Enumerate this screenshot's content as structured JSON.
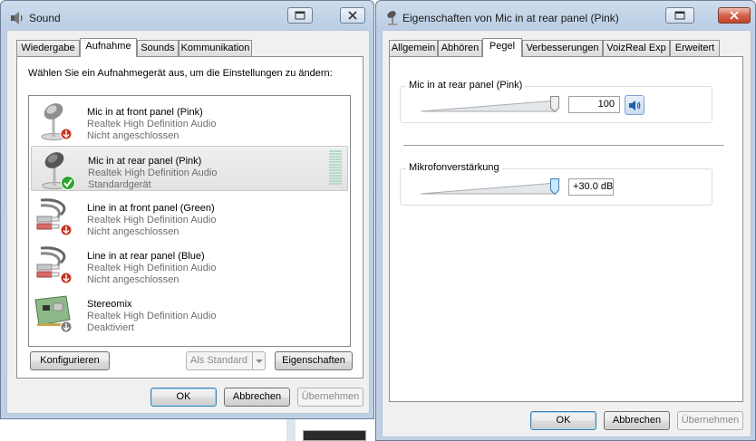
{
  "sound_window": {
    "title": "Sound",
    "tabs": [
      "Wiedergabe",
      "Aufnahme",
      "Sounds",
      "Kommunikation"
    ],
    "active_tab": "Aufnahme",
    "instruction": "Wählen Sie ein Aufnahmegerät aus, um die Einstellungen zu ändern:",
    "devices": [
      {
        "name": "Mic in at front panel (Pink)",
        "driver": "Realtek High Definition Audio",
        "status": "Nicht angeschlossen",
        "icon": "microphone-icon",
        "badge": "red-down-arrow"
      },
      {
        "name": "Mic in at rear panel (Pink)",
        "driver": "Realtek High Definition Audio",
        "status": "Standardgerät",
        "icon": "microphone-icon",
        "badge": "green-check"
      },
      {
        "name": "Line in at front panel (Green)",
        "driver": "Realtek High Definition Audio",
        "status": "Nicht angeschlossen",
        "icon": "rca-cable-icon",
        "badge": "red-down-arrow"
      },
      {
        "name": "Line in at rear panel (Blue)",
        "driver": "Realtek High Definition Audio",
        "status": "Nicht angeschlossen",
        "icon": "rca-cable-icon",
        "badge": "red-down-arrow"
      },
      {
        "name": "Stereomix",
        "driver": "Realtek High Definition Audio",
        "status": "Deaktiviert",
        "icon": "sound-card-icon",
        "badge": "gray-down-arrow"
      }
    ],
    "buttons": {
      "configure": "Konfigurieren",
      "set_default": "Als Standard",
      "properties": "Eigenschaften",
      "ok": "OK",
      "cancel": "Abbrechen",
      "apply": "Übernehmen"
    }
  },
  "props_window": {
    "title": "Eigenschaften von Mic in at rear panel (Pink)",
    "tabs": [
      "Allgemein",
      "Abhören",
      "Pegel",
      "Verbesserungen",
      "VoizReal Exp",
      "Erweitert"
    ],
    "active_tab": "Pegel",
    "level": {
      "label": "Mic in at rear panel (Pink)",
      "value": "100",
      "fraction": 1.0
    },
    "boost": {
      "label": "Mikrofonverstärkung",
      "value": "+30.0 dB",
      "fraction": 1.0
    },
    "buttons": {
      "ok": "OK",
      "cancel": "Abbrechen",
      "apply": "Übernehmen"
    }
  },
  "colors": {
    "selection": "#e6e6e6",
    "accent_blue": "#3c7fb1",
    "check_green": "#2fa52f",
    "badge_red": "#c8321e"
  }
}
